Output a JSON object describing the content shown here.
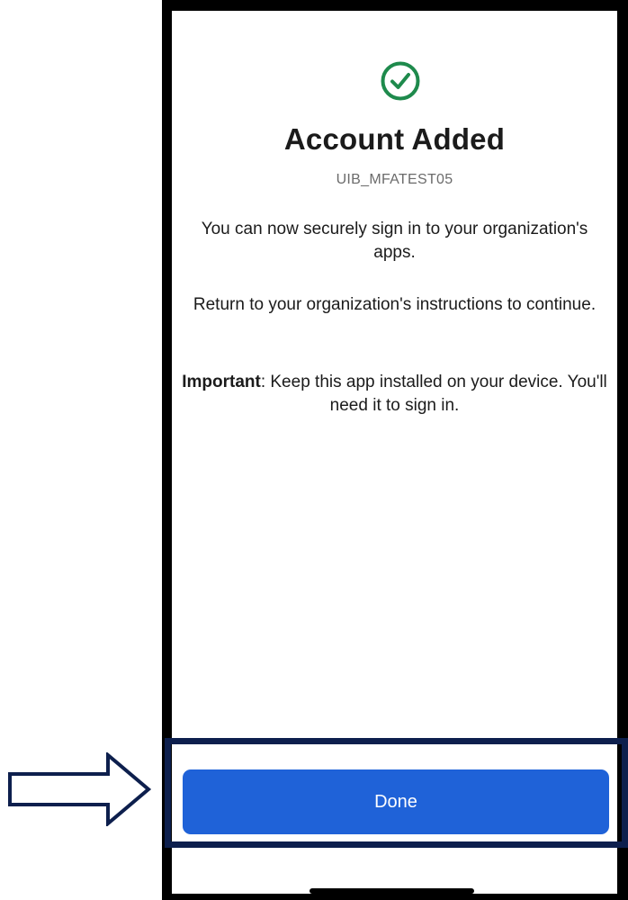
{
  "screen": {
    "title": "Account Added",
    "account_id": "UIB_MFATEST05",
    "paragraph1": "You can now securely sign in to your organization's apps.",
    "paragraph2": "Return to your organization's instructions to continue.",
    "paragraph3_bold": "Important",
    "paragraph3_rest": ": Keep this app installed on your device. You'll need it to sign in."
  },
  "actions": {
    "done_label": "Done"
  },
  "icons": {
    "success": "check-circle-icon",
    "pointer": "arrow-right-icon"
  },
  "colors": {
    "success_green": "#1e8a4c",
    "button_blue": "#1f62d8",
    "highlight_navy": "#0d1f4d"
  }
}
